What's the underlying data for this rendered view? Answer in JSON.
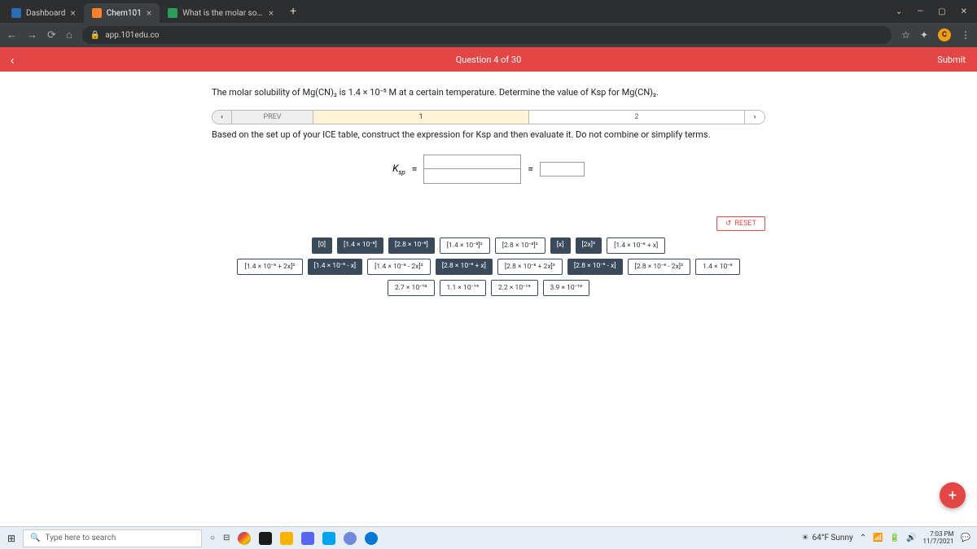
{
  "browser": {
    "tabs": [
      {
        "title": "Dashboard",
        "favicon_color": "#2a6db0"
      },
      {
        "title": "Chem101",
        "favicon_color": "#ff7f2a"
      },
      {
        "title": "What is the molar solubility of M",
        "favicon_color": "#2a9d5c"
      }
    ],
    "url": "app.101edu.co",
    "win_min": "—",
    "win_max": "▢",
    "win_close": "✕"
  },
  "header": {
    "question": "Question 4 of 30",
    "submit": "Submit"
  },
  "prompt": "The molar solubility of Mg(CN)₂ is 1.4 × 10⁻⁵ M at a certain temperature. Determine the value of Ksp for Mg(CN)₂.",
  "steps": {
    "prev": "PREV",
    "s1": "1",
    "s2": "2"
  },
  "instruction": "Based on the set up of your ICE table, construct the expression for Ksp and then evaluate it. Do not combine or simplify terms.",
  "equation": {
    "ksp_label": "Ksp",
    "equals": "="
  },
  "reset": "RESET",
  "chips": {
    "row1": [
      "[0]",
      "[1.4 × 10⁻⁵]",
      "[2.8 × 10⁻⁵]",
      "[1.4 × 10⁻⁵]²",
      "[2.8 × 10⁻⁵]²",
      "[x]",
      "[2x]²",
      "[1.4 × 10⁻⁵ + x]"
    ],
    "row2": [
      "[1.4 × 10⁻⁵ + 2x]²",
      "[1.4 × 10⁻⁵ - x]",
      "[1.4 × 10⁻⁵ - 2x]²",
      "[2.8 × 10⁻⁵ + x]",
      "[2.8 × 10⁻⁵ + 2x]²",
      "[2.8 × 10⁻⁵ - x]",
      "[2.8 × 10⁻⁵ - 2x]²",
      "1.4 × 10⁻⁵"
    ],
    "row3": [
      "2.7 × 10⁻¹⁰",
      "1.1 × 10⁻¹⁴",
      "2.2 × 10⁻¹⁴",
      "3.9 × 10⁻¹⁰"
    ]
  },
  "taskbar": {
    "search_placeholder": "Type here to search",
    "weather": "64°F Sunny",
    "time": "7:03 PM",
    "date": "11/7/2021"
  }
}
